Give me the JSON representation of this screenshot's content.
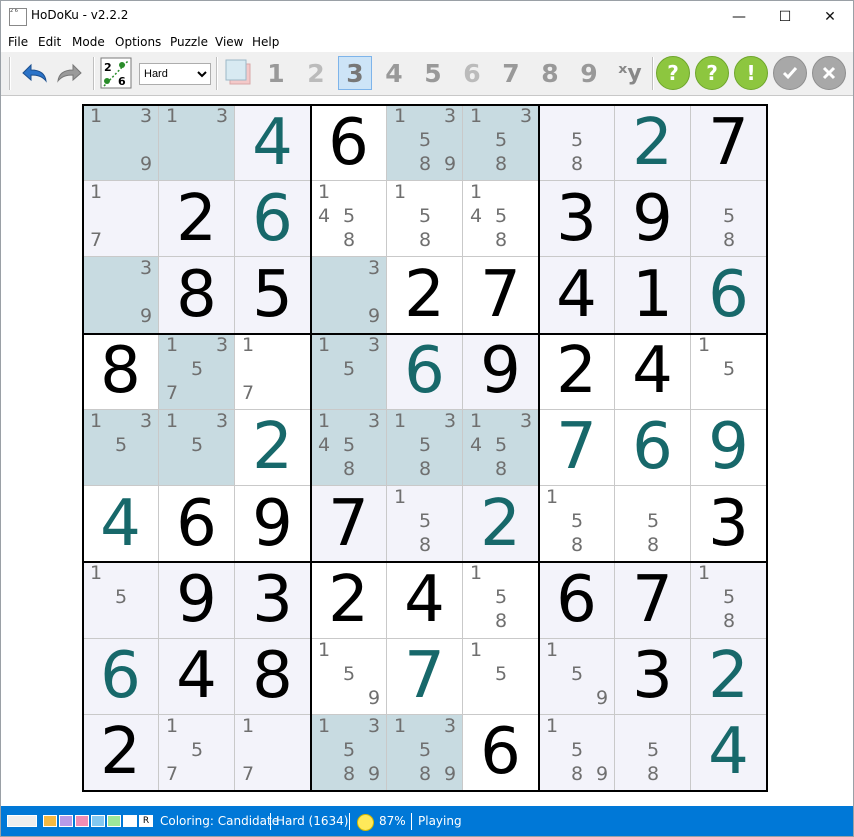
{
  "window": {
    "title": "HoDoKu - v2.2.2",
    "icon_digits": "2 6",
    "controls": {
      "minimize": "—",
      "maximize": "☐",
      "close": "✕"
    }
  },
  "menu": [
    "File",
    "Edit",
    "Mode",
    "Options",
    "Puzzle",
    "View",
    "Help"
  ],
  "toolbar": {
    "difficulty": "Hard",
    "numbers": [
      "1",
      "2",
      "3",
      "4",
      "5",
      "6",
      "7",
      "8",
      "9"
    ],
    "selected_number": "3",
    "xy_label": "ˣy",
    "help_buttons": [
      "?",
      "?",
      "!"
    ],
    "colors": {
      "green": "#8dc63f",
      "gray": "#a8a8a8",
      "accent": "#cde4f7"
    },
    "icons": [
      "undo-icon",
      "redo-icon",
      "candidate-mode-icon",
      "color-filter-icon",
      "xy-filter-icon",
      "hint-icon",
      "hint-icon-2",
      "solution-step-icon",
      "check-icon",
      "abort-icon"
    ]
  },
  "board": {
    "colors": {
      "given": "#000000",
      "placed": "#17686a",
      "candidate": "#6f6f6f",
      "highlight": "#c8dbe1",
      "tint": "#f3f3fa",
      "white": "#ffffff"
    },
    "cells": [
      [
        {
          "c": [
            1,
            3,
            9
          ],
          "h": 1
        },
        {
          "c": [
            1,
            3
          ],
          "h": 1
        },
        {
          "v": "4",
          "p": 1
        },
        {
          "v": "6"
        },
        {
          "c": [
            1,
            3,
            5,
            8,
            9
          ],
          "h": 1
        },
        {
          "c": [
            1,
            3,
            5,
            8
          ],
          "h": 1
        },
        {
          "c": [
            5,
            8
          ]
        },
        {
          "v": "2",
          "p": 1
        },
        {
          "v": "7"
        }
      ],
      [
        {
          "c": [
            1,
            7
          ]
        },
        {
          "v": "2"
        },
        {
          "v": "6",
          "p": 1
        },
        {
          "c": [
            1,
            4,
            5,
            8
          ]
        },
        {
          "c": [
            1,
            5,
            8
          ]
        },
        {
          "c": [
            1,
            4,
            5,
            8
          ]
        },
        {
          "v": "3"
        },
        {
          "v": "9"
        },
        {
          "c": [
            5,
            8
          ]
        }
      ],
      [
        {
          "c": [
            3,
            9
          ],
          "h": 1
        },
        {
          "v": "8"
        },
        {
          "v": "5"
        },
        {
          "c": [
            3,
            9
          ],
          "h": 1
        },
        {
          "v": "2"
        },
        {
          "v": "7"
        },
        {
          "v": "4"
        },
        {
          "v": "1"
        },
        {
          "v": "6",
          "p": 1
        }
      ],
      [
        {
          "v": "8"
        },
        {
          "c": [
            1,
            3,
            5,
            7
          ],
          "h": 1
        },
        {
          "c": [
            1,
            7
          ]
        },
        {
          "c": [
            1,
            3,
            5
          ],
          "h": 1
        },
        {
          "v": "6",
          "p": 1
        },
        {
          "v": "9"
        },
        {
          "v": "2"
        },
        {
          "v": "4"
        },
        {
          "c": [
            1,
            5
          ]
        }
      ],
      [
        {
          "c": [
            1,
            3,
            5
          ],
          "h": 1
        },
        {
          "c": [
            1,
            3,
            5
          ],
          "h": 1
        },
        {
          "v": "2",
          "p": 1
        },
        {
          "c": [
            1,
            3,
            4,
            5,
            8
          ],
          "h": 1
        },
        {
          "c": [
            1,
            3,
            5,
            8
          ],
          "h": 1
        },
        {
          "c": [
            1,
            3,
            4,
            5,
            8
          ],
          "h": 1
        },
        {
          "v": "7",
          "p": 1
        },
        {
          "v": "6",
          "p": 1
        },
        {
          "v": "9",
          "p": 1
        }
      ],
      [
        {
          "v": "4",
          "p": 1
        },
        {
          "v": "6"
        },
        {
          "v": "9"
        },
        {
          "v": "7"
        },
        {
          "c": [
            1,
            5,
            8
          ]
        },
        {
          "v": "2",
          "p": 1
        },
        {
          "c": [
            1,
            5,
            8
          ]
        },
        {
          "c": [
            5,
            8
          ]
        },
        {
          "v": "3"
        }
      ],
      [
        {
          "c": [
            1,
            5
          ]
        },
        {
          "v": "9"
        },
        {
          "v": "3"
        },
        {
          "v": "2"
        },
        {
          "v": "4"
        },
        {
          "c": [
            1,
            5,
            8
          ]
        },
        {
          "v": "6"
        },
        {
          "v": "7"
        },
        {
          "c": [
            1,
            5,
            8
          ]
        }
      ],
      [
        {
          "v": "6",
          "p": 1
        },
        {
          "v": "4"
        },
        {
          "v": "8"
        },
        {
          "c": [
            1,
            5,
            9
          ]
        },
        {
          "v": "7",
          "p": 1
        },
        {
          "c": [
            1,
            5
          ]
        },
        {
          "c": [
            1,
            5,
            9
          ]
        },
        {
          "v": "3"
        },
        {
          "v": "2",
          "p": 1
        }
      ],
      [
        {
          "v": "2"
        },
        {
          "c": [
            1,
            5,
            7
          ]
        },
        {
          "c": [
            1,
            7
          ]
        },
        {
          "c": [
            1,
            3,
            5,
            8,
            9
          ],
          "h": 1
        },
        {
          "c": [
            1,
            3,
            5,
            8,
            9
          ],
          "h": 1
        },
        {
          "v": "6"
        },
        {
          "c": [
            1,
            5,
            8,
            9
          ]
        },
        {
          "c": [
            5,
            8
          ]
        },
        {
          "v": "4",
          "p": 1
        }
      ]
    ]
  },
  "status": {
    "palette": [
      "#eeeeee",
      "#f5b942",
      "#b79be8",
      "#f08db5",
      "#84c8f0",
      "#9ee89a",
      "#ffffff"
    ],
    "reset_label": "R",
    "coloring": "Coloring: Candidate",
    "difficulty": "Hard (1634)",
    "progress": "87%",
    "state": "Playing"
  }
}
